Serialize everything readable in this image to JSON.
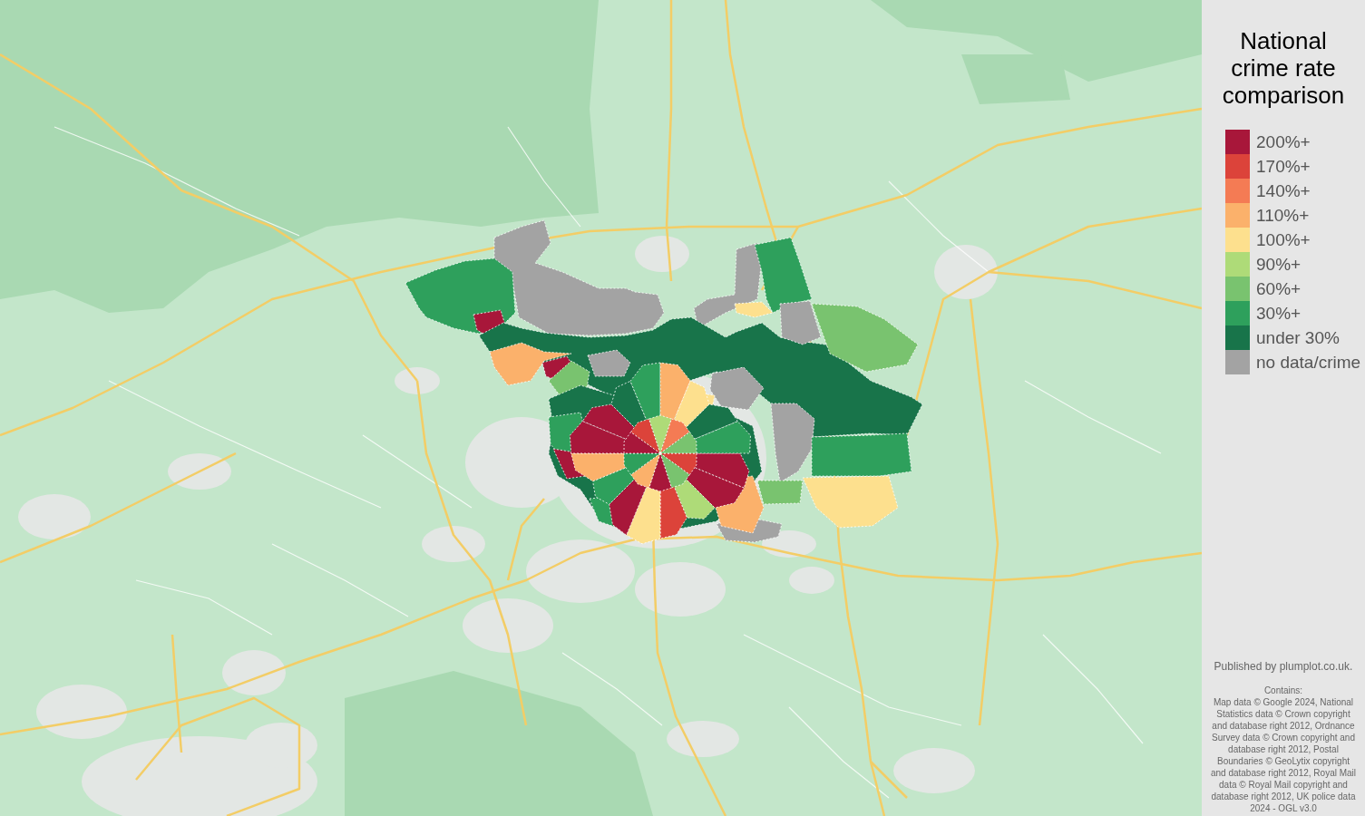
{
  "legend": {
    "title": "National crime rate comparison",
    "items": [
      {
        "label": "200%+",
        "color": "#a8173a"
      },
      {
        "label": "170%+",
        "color": "#dc433a"
      },
      {
        "label": "140%+",
        "color": "#f47b54"
      },
      {
        "label": "110%+",
        "color": "#fbb16b"
      },
      {
        "label": "100%+",
        "color": "#fde08e"
      },
      {
        "label": "90%+",
        "color": "#aedb78"
      },
      {
        "label": "60%+",
        "color": "#79c36f"
      },
      {
        "label": "30%+",
        "color": "#2ea05c"
      },
      {
        "label": "under 30%",
        "color": "#18744a"
      },
      {
        "label": "no data/crime",
        "color": "#a3a3a3"
      }
    ]
  },
  "attribution": {
    "publisher": "Published by plumplot.co.uk.",
    "heading": "Contains:",
    "sources": "Map data © Google 2024, National Statistics data © Crown copyright and database right 2012, Ordnance Survey data © Crown copyright and database right 2012, Postal Boundaries © GeoLytix copyright and database right 2012, Royal Mail data © Royal Mail copyright and database right 2012, UK police data 2024 - OGL v3.0"
  }
}
